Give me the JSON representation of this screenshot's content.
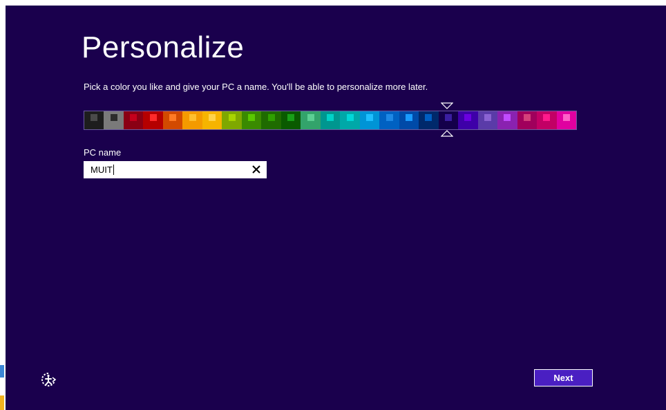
{
  "page": {
    "title": "Personalize",
    "subtitle": "Pick a color you like and give your PC a name. You'll be able to personalize more later."
  },
  "colors": {
    "background": "#1a004d",
    "accent_button": "#4a1fc2",
    "selected_index": 19,
    "swatches": [
      {
        "bg": "#1d1d1d",
        "dot": "#4a4a4a"
      },
      {
        "bg": "#7a7a7a",
        "dot": "#2c2c2c"
      },
      {
        "bg": "#8a0014",
        "dot": "#c4001c"
      },
      {
        "bg": "#b50000",
        "dot": "#ff2a2a"
      },
      {
        "bg": "#d24a00",
        "dot": "#ff7a24"
      },
      {
        "bg": "#f49a00",
        "dot": "#ffbf2e"
      },
      {
        "bg": "#f6b400",
        "dot": "#ffd34a"
      },
      {
        "bg": "#7fa800",
        "dot": "#a8d400"
      },
      {
        "bg": "#3a8a00",
        "dot": "#5ac800"
      },
      {
        "bg": "#1f6b00",
        "dot": "#2fa000"
      },
      {
        "bg": "#0a5a00",
        "dot": "#18a018"
      },
      {
        "bg": "#33a36b",
        "dot": "#5ccf94"
      },
      {
        "bg": "#00968f",
        "dot": "#00d2c8"
      },
      {
        "bg": "#00a8a8",
        "dot": "#00d8d8"
      },
      {
        "bg": "#0094d6",
        "dot": "#1fbfff"
      },
      {
        "bg": "#0061c2",
        "dot": "#1e88e5"
      },
      {
        "bg": "#004aa8",
        "dot": "#1a9bff"
      },
      {
        "bg": "#00296b",
        "dot": "#005ec2"
      },
      {
        "bg": "#14004a",
        "dot": "#3a1ea0"
      },
      {
        "bg": "#3e00a8",
        "dot": "#6a00e0"
      },
      {
        "bg": "#5a3ba8",
        "dot": "#8a63d2"
      },
      {
        "bg": "#8a22b0",
        "dot": "#c04cff"
      },
      {
        "bg": "#a0005c",
        "dot": "#d4407a"
      },
      {
        "bg": "#c20065",
        "dot": "#ff1a8c"
      },
      {
        "bg": "#e000a0",
        "dot": "#ff60c8"
      }
    ]
  },
  "pc_name": {
    "label": "PC name",
    "value": "MUIT"
  },
  "icons": {
    "clear": "close-icon",
    "accessibility": "ease-of-access-icon",
    "selector_top": "triangle-down-icon",
    "selector_bottom": "triangle-up-icon"
  },
  "buttons": {
    "next_label": "Next"
  }
}
